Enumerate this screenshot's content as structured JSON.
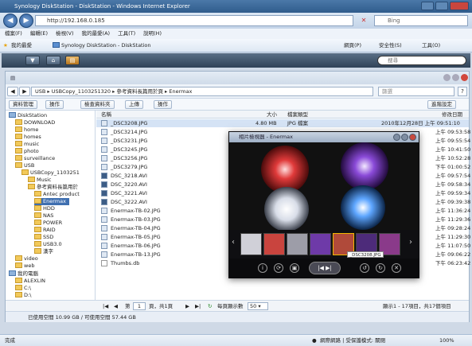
{
  "browser": {
    "title": "Synology DiskStation - DiskStation - Windows Internet Explorer",
    "url": "http://192.168.0.185",
    "search_placeholder": "Bing",
    "menu": [
      "檔案(F)",
      "編輯(E)",
      "檢視(V)",
      "我的最愛(A)",
      "工具(T)",
      "說明(H)"
    ],
    "favorites_label": "我的最愛",
    "fav_item": "Synology DiskStation - DiskStation",
    "toolbar_right": [
      "網頁(P)",
      "安全性(S)",
      "工具(O)"
    ],
    "status_left": "完成",
    "status_zone": "網際網路 | 受保護模式: 關閉",
    "zoom": "100%"
  },
  "dsm": {
    "search_placeholder": "搜尋"
  },
  "filestation": {
    "path": "USB ▸ USBCopy_1103251320 ▸ 參考資料長篇用於頁 ▸ Enermax",
    "filter_placeholder": "篩選",
    "toolbar": [
      "資料管理",
      "操作",
      "檢查資料夾",
      "上傳",
      "操作"
    ],
    "toolbar_right": "進階設定",
    "columns": {
      "name": "名稱",
      "size": "大小",
      "type": "檔案類型",
      "modified": "修改日期"
    },
    "tree": [
      {
        "label": "DiskStation",
        "level": 0
      },
      {
        "label": "DOWNLOAD",
        "level": 1
      },
      {
        "label": "home",
        "level": 1
      },
      {
        "label": "homes",
        "level": 1
      },
      {
        "label": "music",
        "level": 1
      },
      {
        "label": "photo",
        "level": 1
      },
      {
        "label": "surveillance",
        "level": 1
      },
      {
        "label": "USB",
        "level": 1
      },
      {
        "label": "USBCopy_1103251",
        "level": 2
      },
      {
        "label": "Music",
        "level": 3
      },
      {
        "label": "參考資料長篇用於",
        "level": 3
      },
      {
        "label": "Antec product",
        "level": 4
      },
      {
        "label": "Enermax",
        "level": 4
      },
      {
        "label": "HDD",
        "level": 4
      },
      {
        "label": "NAS",
        "level": 4
      },
      {
        "label": "POWER",
        "level": 4
      },
      {
        "label": "RAID",
        "level": 4
      },
      {
        "label": "SSD",
        "level": 4
      },
      {
        "label": "USB3.0",
        "level": 4
      },
      {
        "label": "漢字",
        "level": 4
      },
      {
        "label": "video",
        "level": 1
      },
      {
        "label": "web",
        "level": 1
      },
      {
        "label": "我的電腦",
        "level": 0
      },
      {
        "label": "ALEXLIN",
        "level": 1
      },
      {
        "label": "C:\\",
        "level": 1
      },
      {
        "label": "D:\\",
        "level": 1
      }
    ],
    "files": [
      {
        "name": "_DSC3208.JPG",
        "size": "4.80 MB",
        "type": "JPG 檔案",
        "date": "2010年12月28日 上午 09:51:10",
        "kind": "img"
      },
      {
        "name": "_DSC3214.JPG",
        "size": "",
        "type": "",
        "date": "上午 09:53:58",
        "kind": "img"
      },
      {
        "name": "_DSC3231.JPG",
        "size": "",
        "type": "",
        "date": "上午 09:55:54",
        "kind": "img"
      },
      {
        "name": "_DSC3245.JPG",
        "size": "",
        "type": "",
        "date": "上午 10:41:50",
        "kind": "img"
      },
      {
        "name": "_DSC3256.JPG",
        "size": "",
        "type": "",
        "date": "上午 10:52:28",
        "kind": "img"
      },
      {
        "name": "_DSC3279.JPG",
        "size": "",
        "type": "",
        "date": "下午 01:00:52",
        "kind": "img"
      },
      {
        "name": "DSC_3218.AVI",
        "size": "",
        "type": "",
        "date": "上午 09:57:54",
        "kind": "avi"
      },
      {
        "name": "DSC_3220.AVI",
        "size": "",
        "type": "",
        "date": "上午 09:58:34",
        "kind": "avi"
      },
      {
        "name": "DSC_3221.AVI",
        "size": "",
        "type": "",
        "date": "上午 09:59:34",
        "kind": "avi"
      },
      {
        "name": "DSC_3222.AVI",
        "size": "",
        "type": "",
        "date": "上午 09:39:38",
        "kind": "avi"
      },
      {
        "name": "Enermax-TB-02.JPG",
        "size": "",
        "type": "",
        "date": "上午 11:36:24",
        "kind": "img"
      },
      {
        "name": "Enermax-TB-03.JPG",
        "size": "",
        "type": "",
        "date": "上午 11:29:36",
        "kind": "img"
      },
      {
        "name": "Enermax-TB-04.JPG",
        "size": "",
        "type": "",
        "date": "上午 09:28:24",
        "kind": "img"
      },
      {
        "name": "Enermax-TB-05.JPG",
        "size": "",
        "type": "",
        "date": "上午 11:29:30",
        "kind": "img"
      },
      {
        "name": "Enermax-TB-06.JPG",
        "size": "",
        "type": "",
        "date": "上午 11:07:50",
        "kind": "img"
      },
      {
        "name": "Enermax-TB-13.JPG",
        "size": "",
        "type": "",
        "date": "上午 09:06:22",
        "kind": "img"
      },
      {
        "name": "Thumbs.db",
        "size": "",
        "type": "",
        "date": "下午 06:23:42",
        "kind": "db"
      }
    ],
    "pager": {
      "page_prefix": "第",
      "page": "1",
      "page_suffix": "頁，共1頁",
      "per_page_label": "每頁顯示數",
      "per_page": "50",
      "summary": "顯示1 - 17項目，共17個項目"
    },
    "status": "已使用空間 10.99 GB / 可使用空間 57.44 GB"
  },
  "viewer": {
    "title": "相片檢視器 - Enermax",
    "tooltip": "_DSC3208.JPG"
  }
}
